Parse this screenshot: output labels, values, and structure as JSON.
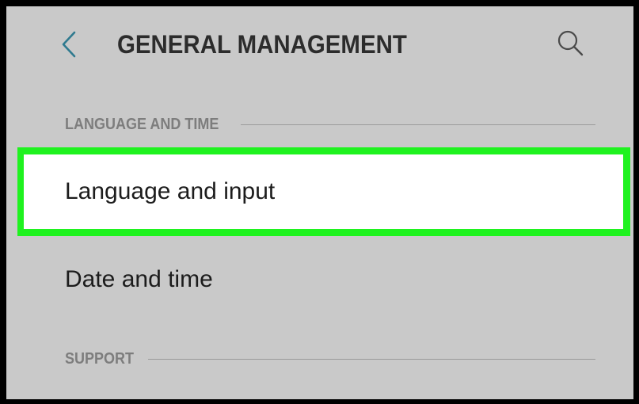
{
  "header": {
    "title": "GENERAL MANAGEMENT",
    "back_icon": "chevron-left-icon",
    "search_icon": "search-icon"
  },
  "sections": [
    {
      "title": "LANGUAGE AND TIME",
      "items": [
        {
          "label": "Language and input",
          "highlighted": true
        },
        {
          "label": "Date and time",
          "highlighted": false
        }
      ]
    },
    {
      "title": "SUPPORT",
      "items": []
    }
  ],
  "colors": {
    "background": "#c9c9c9",
    "highlight": "#1ff21f",
    "selected_row": "#ffffff",
    "frame": "#000000"
  }
}
